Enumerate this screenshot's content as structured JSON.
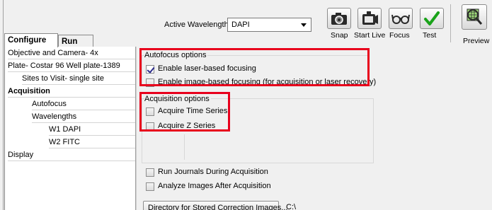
{
  "tabs": [
    {
      "label": "Configure",
      "active": true
    },
    {
      "label": "Run",
      "active": false
    }
  ],
  "tree": [
    {
      "label": "Objective and Camera- 4x",
      "indent": 0,
      "bold": false
    },
    {
      "label": "Plate- Costar 96 Well plate-1389",
      "indent": 0,
      "bold": false
    },
    {
      "label": "Sites to Visit- single site",
      "indent": 1,
      "bold": false
    },
    {
      "label": "Acquisition",
      "indent": 0,
      "bold": true
    },
    {
      "label": "Autofocus",
      "indent": 2,
      "bold": false
    },
    {
      "label": "Wavelengths",
      "indent": 2,
      "bold": false
    },
    {
      "label": "W1 DAPI",
      "indent": 3,
      "bold": false
    },
    {
      "label": "W2 FITC",
      "indent": 3,
      "bold": false
    },
    {
      "label": "Display",
      "indent": 0,
      "bold": false
    }
  ],
  "toolbar": {
    "active_wavelength_label": "Active Wavelength",
    "active_wavelength_value": "DAPI",
    "snap_label": "Snap",
    "start_live_label": "Start Live",
    "focus_label": "Focus",
    "test_label": "Test",
    "preview_label": "Preview"
  },
  "autofocus": {
    "title": "Autofocus options",
    "laser_label": "Enable laser-based focusing",
    "laser_checked": true,
    "image_label": "Enable image-based focusing (for acquisition or laser recovery)",
    "image_checked": false
  },
  "acquisition": {
    "title": "Acquisition options",
    "time_series_label": "Acquire Time Series",
    "time_series_checked": false,
    "z_series_label": "Acquire Z Series",
    "z_series_checked": false
  },
  "options": {
    "run_journals_label": "Run Journals During Acquisition",
    "analyze_images_label": "Analyze Images After Acquisition"
  },
  "correction": {
    "button_label": "Directory for Stored Correction Images...",
    "path": "C:\\"
  },
  "colors": {
    "highlight_red": "#e8001c",
    "checkmark_green": "#1aa31a",
    "checkbox_tick": "#2b2b8c"
  }
}
